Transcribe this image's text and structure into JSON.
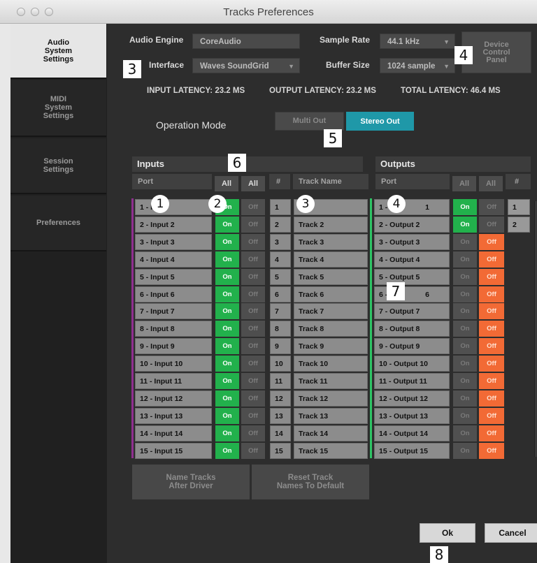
{
  "window": {
    "title": "Tracks Preferences"
  },
  "sidebar": {
    "tabs": [
      {
        "label": "Audio\nSystem\nSettings",
        "active": true
      },
      {
        "label": "MIDI\nSystem\nSettings",
        "active": false
      },
      {
        "label": "Session\nSettings",
        "active": false
      },
      {
        "label": "Preferences",
        "active": false
      }
    ]
  },
  "engine": {
    "audio_engine_label": "Audio Engine",
    "audio_engine_value": "CoreAudio",
    "interface_label": "Interface",
    "interface_value": "Waves SoundGrid",
    "sample_rate_label": "Sample Rate",
    "sample_rate_value": "44.1 kHz",
    "buffer_size_label": "Buffer Size",
    "buffer_size_value": "1024 sample",
    "device_panel_label": "Device\nControl\nPanel"
  },
  "latency": {
    "input": "INPUT LATENCY: 23.2 MS",
    "output": "OUTPUT LATENCY: 23.2 MS",
    "total": "TOTAL LATENCY: 46.4 MS"
  },
  "operation_mode": {
    "label": "Operation Mode",
    "multi_out": "Multi Out",
    "stereo_out": "Stereo Out",
    "selected": "Stereo Out"
  },
  "inputs": {
    "title": "Inputs",
    "port_header": "Port",
    "all_on_label": "All",
    "all_off_label": "All",
    "num_header": "#",
    "track_header": "Track Name"
  },
  "outputs": {
    "title": "Outputs",
    "port_header": "Port",
    "all_on_label": "All",
    "all_off_label": "All",
    "num_header": "#"
  },
  "toggle_labels": {
    "on": "On",
    "off": "Off"
  },
  "input_rows": [
    {
      "port": "1 - I",
      "on": true,
      "num": "1",
      "track": "Tr"
    },
    {
      "port": "2 - Input 2",
      "on": true,
      "num": "2",
      "track": "Track  2"
    },
    {
      "port": "3 - Input 3",
      "on": true,
      "num": "3",
      "track": "Track  3"
    },
    {
      "port": "4 - Input 4",
      "on": true,
      "num": "4",
      "track": "Track  4"
    },
    {
      "port": "5 - Input 5",
      "on": true,
      "num": "5",
      "track": "Track  5"
    },
    {
      "port": "6 - Input 6",
      "on": true,
      "num": "6",
      "track": "Track  6"
    },
    {
      "port": "7 - Input 7",
      "on": true,
      "num": "7",
      "track": "Track  7"
    },
    {
      "port": "8 - Input 8",
      "on": true,
      "num": "8",
      "track": "Track  8"
    },
    {
      "port": "9 - Input 9",
      "on": true,
      "num": "9",
      "track": "Track  9"
    },
    {
      "port": "10 - Input 10",
      "on": true,
      "num": "10",
      "track": "Track  10"
    },
    {
      "port": "11 - Input 11",
      "on": true,
      "num": "11",
      "track": "Track  11"
    },
    {
      "port": "12 - Input 12",
      "on": true,
      "num": "12",
      "track": "Track  12"
    },
    {
      "port": "13 - Input 13",
      "on": true,
      "num": "13",
      "track": "Track  13"
    },
    {
      "port": "14 - Input 14",
      "on": true,
      "num": "14",
      "track": "Track  14"
    },
    {
      "port": "15 - Input 15",
      "on": true,
      "num": "15",
      "track": "Track  15"
    }
  ],
  "output_rows": [
    {
      "port": "1 - O",
      "port_tail": "1",
      "on": true,
      "num": "1"
    },
    {
      "port": "2 - Output 2",
      "on": true,
      "num": "2"
    },
    {
      "port": "3 - Output 3",
      "on": false
    },
    {
      "port": "4 - Output 4",
      "on": false
    },
    {
      "port": "5 - Output 5",
      "on": false
    },
    {
      "port": "6 - ",
      "port_tail": "6",
      "on": false
    },
    {
      "port": "7 - Output 7",
      "on": false
    },
    {
      "port": "8 - Output 8",
      "on": false
    },
    {
      "port": "9 - Output 9",
      "on": false
    },
    {
      "port": "10 - Output 10",
      "on": false
    },
    {
      "port": "11 - Output 11",
      "on": false
    },
    {
      "port": "12 - Output 12",
      "on": false
    },
    {
      "port": "13 - Output 13",
      "on": false
    },
    {
      "port": "14 - Output 14",
      "on": false
    },
    {
      "port": "15 - Output 15",
      "on": false
    }
  ],
  "footer": {
    "name_tracks": "Name Tracks\nAfter Driver",
    "reset_names": "Reset Track\nNames To Default",
    "ok": "Ok",
    "cancel": "Cancel"
  },
  "annotations": {
    "a1": "1",
    "a2": "2",
    "a3": "3",
    "a4": "4",
    "b3": "3",
    "b4": "4",
    "b5": "5",
    "b6": "6",
    "b7": "7",
    "b8": "8"
  },
  "colors": {
    "on": "#22b14c",
    "off_active": "#f26a35",
    "accent": "#1f98a8"
  }
}
